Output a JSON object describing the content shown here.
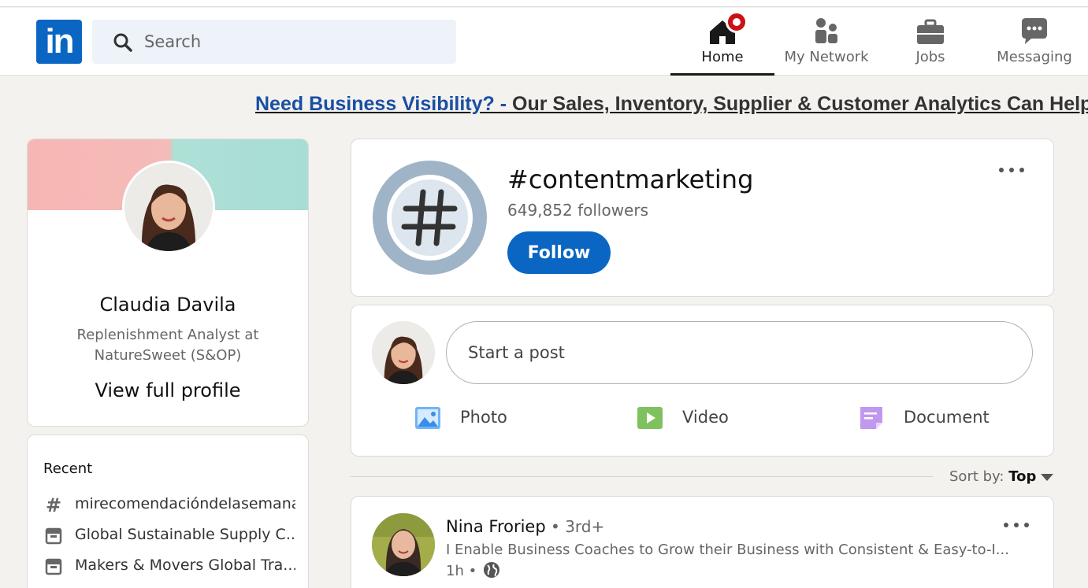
{
  "nav": {
    "logo_text": "in",
    "search_placeholder": "Search",
    "items": [
      {
        "label": "Home",
        "icon": "home-icon"
      },
      {
        "label": "My Network",
        "icon": "network-icon"
      },
      {
        "label": "Jobs",
        "icon": "briefcase-icon"
      },
      {
        "label": "Messaging",
        "icon": "messaging-icon"
      }
    ],
    "active": "Home"
  },
  "ad": {
    "link_text": "Need Business Visibility? - ",
    "body_text": "Our Sales, Inventory, Supplier & Customer Analytics Can Help."
  },
  "profile": {
    "name": "Claudia Davila",
    "headline": "Replenishment Analyst at NatureSweet (S&OP)",
    "view_link": "View full profile"
  },
  "recent": {
    "heading": "Recent",
    "items": [
      {
        "label": "mirecomendacióndelasemana",
        "icon": "hashtag-icon"
      },
      {
        "label": "Global Sustainable Supply C...",
        "icon": "event-icon"
      },
      {
        "label": "Makers & Movers Global Tra...",
        "icon": "event-icon"
      }
    ]
  },
  "hashtag": {
    "title": "#contentmarketing",
    "followers": "649,852 followers",
    "follow_label": "Follow"
  },
  "composer": {
    "placeholder": "Start a post",
    "actions": [
      {
        "label": "Photo",
        "icon": "photo-icon",
        "color": "#70b5f9"
      },
      {
        "label": "Video",
        "icon": "video-icon",
        "color": "#7fc15e"
      },
      {
        "label": "Document",
        "icon": "document-icon",
        "color": "#c198f0"
      }
    ]
  },
  "sort": {
    "prefix": "Sort by:",
    "value": "Top"
  },
  "post": {
    "author": "Nina Froriep",
    "degree": " • 3rd+",
    "bio": "I Enable Business Coaches to Grow their Business with Consistent & Easy-to-I...",
    "time": "1h •"
  },
  "colors": {
    "brand": "#0a66c2",
    "notification": "#cc1016",
    "background": "#f3f2ef"
  }
}
